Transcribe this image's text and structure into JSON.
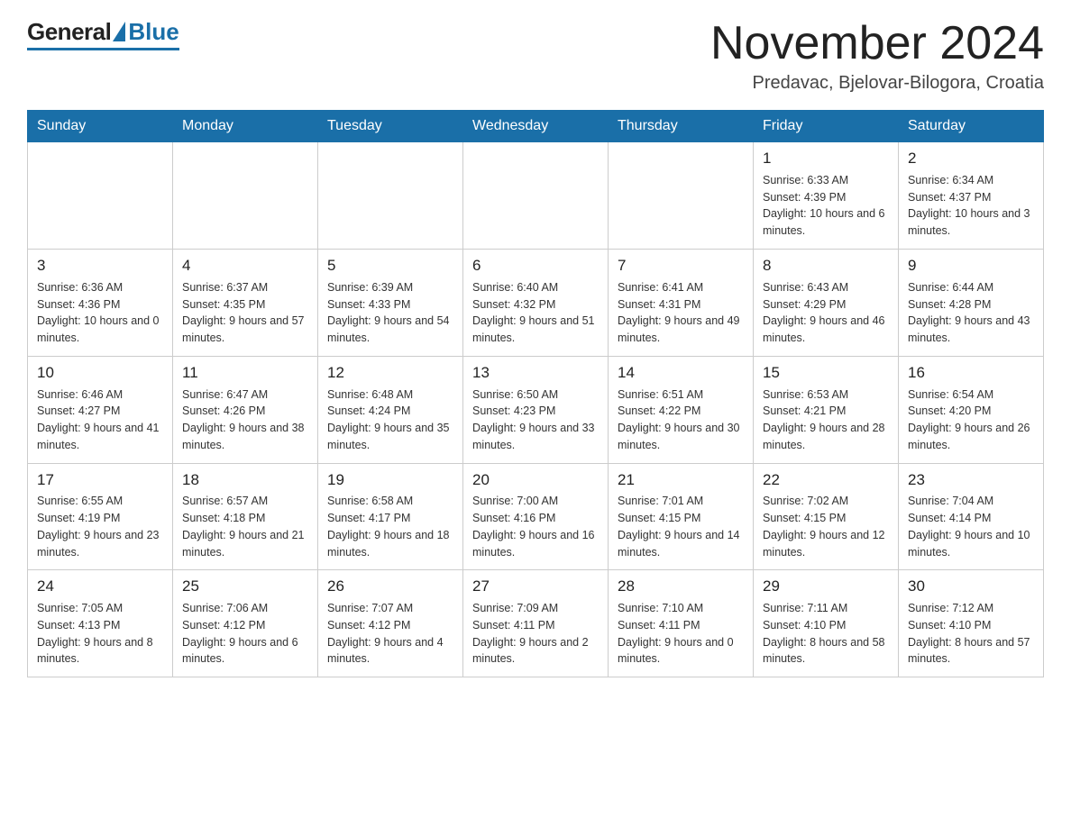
{
  "header": {
    "logo_general": "General",
    "logo_blue": "Blue",
    "month_title": "November 2024",
    "location": "Predavac, Bjelovar-Bilogora, Croatia"
  },
  "days_of_week": [
    "Sunday",
    "Monday",
    "Tuesday",
    "Wednesday",
    "Thursday",
    "Friday",
    "Saturday"
  ],
  "weeks": [
    {
      "days": [
        {
          "number": "",
          "info": ""
        },
        {
          "number": "",
          "info": ""
        },
        {
          "number": "",
          "info": ""
        },
        {
          "number": "",
          "info": ""
        },
        {
          "number": "",
          "info": ""
        },
        {
          "number": "1",
          "info": "Sunrise: 6:33 AM\nSunset: 4:39 PM\nDaylight: 10 hours and 6 minutes."
        },
        {
          "number": "2",
          "info": "Sunrise: 6:34 AM\nSunset: 4:37 PM\nDaylight: 10 hours and 3 minutes."
        }
      ]
    },
    {
      "days": [
        {
          "number": "3",
          "info": "Sunrise: 6:36 AM\nSunset: 4:36 PM\nDaylight: 10 hours and 0 minutes."
        },
        {
          "number": "4",
          "info": "Sunrise: 6:37 AM\nSunset: 4:35 PM\nDaylight: 9 hours and 57 minutes."
        },
        {
          "number": "5",
          "info": "Sunrise: 6:39 AM\nSunset: 4:33 PM\nDaylight: 9 hours and 54 minutes."
        },
        {
          "number": "6",
          "info": "Sunrise: 6:40 AM\nSunset: 4:32 PM\nDaylight: 9 hours and 51 minutes."
        },
        {
          "number": "7",
          "info": "Sunrise: 6:41 AM\nSunset: 4:31 PM\nDaylight: 9 hours and 49 minutes."
        },
        {
          "number": "8",
          "info": "Sunrise: 6:43 AM\nSunset: 4:29 PM\nDaylight: 9 hours and 46 minutes."
        },
        {
          "number": "9",
          "info": "Sunrise: 6:44 AM\nSunset: 4:28 PM\nDaylight: 9 hours and 43 minutes."
        }
      ]
    },
    {
      "days": [
        {
          "number": "10",
          "info": "Sunrise: 6:46 AM\nSunset: 4:27 PM\nDaylight: 9 hours and 41 minutes."
        },
        {
          "number": "11",
          "info": "Sunrise: 6:47 AM\nSunset: 4:26 PM\nDaylight: 9 hours and 38 minutes."
        },
        {
          "number": "12",
          "info": "Sunrise: 6:48 AM\nSunset: 4:24 PM\nDaylight: 9 hours and 35 minutes."
        },
        {
          "number": "13",
          "info": "Sunrise: 6:50 AM\nSunset: 4:23 PM\nDaylight: 9 hours and 33 minutes."
        },
        {
          "number": "14",
          "info": "Sunrise: 6:51 AM\nSunset: 4:22 PM\nDaylight: 9 hours and 30 minutes."
        },
        {
          "number": "15",
          "info": "Sunrise: 6:53 AM\nSunset: 4:21 PM\nDaylight: 9 hours and 28 minutes."
        },
        {
          "number": "16",
          "info": "Sunrise: 6:54 AM\nSunset: 4:20 PM\nDaylight: 9 hours and 26 minutes."
        }
      ]
    },
    {
      "days": [
        {
          "number": "17",
          "info": "Sunrise: 6:55 AM\nSunset: 4:19 PM\nDaylight: 9 hours and 23 minutes."
        },
        {
          "number": "18",
          "info": "Sunrise: 6:57 AM\nSunset: 4:18 PM\nDaylight: 9 hours and 21 minutes."
        },
        {
          "number": "19",
          "info": "Sunrise: 6:58 AM\nSunset: 4:17 PM\nDaylight: 9 hours and 18 minutes."
        },
        {
          "number": "20",
          "info": "Sunrise: 7:00 AM\nSunset: 4:16 PM\nDaylight: 9 hours and 16 minutes."
        },
        {
          "number": "21",
          "info": "Sunrise: 7:01 AM\nSunset: 4:15 PM\nDaylight: 9 hours and 14 minutes."
        },
        {
          "number": "22",
          "info": "Sunrise: 7:02 AM\nSunset: 4:15 PM\nDaylight: 9 hours and 12 minutes."
        },
        {
          "number": "23",
          "info": "Sunrise: 7:04 AM\nSunset: 4:14 PM\nDaylight: 9 hours and 10 minutes."
        }
      ]
    },
    {
      "days": [
        {
          "number": "24",
          "info": "Sunrise: 7:05 AM\nSunset: 4:13 PM\nDaylight: 9 hours and 8 minutes."
        },
        {
          "number": "25",
          "info": "Sunrise: 7:06 AM\nSunset: 4:12 PM\nDaylight: 9 hours and 6 minutes."
        },
        {
          "number": "26",
          "info": "Sunrise: 7:07 AM\nSunset: 4:12 PM\nDaylight: 9 hours and 4 minutes."
        },
        {
          "number": "27",
          "info": "Sunrise: 7:09 AM\nSunset: 4:11 PM\nDaylight: 9 hours and 2 minutes."
        },
        {
          "number": "28",
          "info": "Sunrise: 7:10 AM\nSunset: 4:11 PM\nDaylight: 9 hours and 0 minutes."
        },
        {
          "number": "29",
          "info": "Sunrise: 7:11 AM\nSunset: 4:10 PM\nDaylight: 8 hours and 58 minutes."
        },
        {
          "number": "30",
          "info": "Sunrise: 7:12 AM\nSunset: 4:10 PM\nDaylight: 8 hours and 57 minutes."
        }
      ]
    }
  ]
}
